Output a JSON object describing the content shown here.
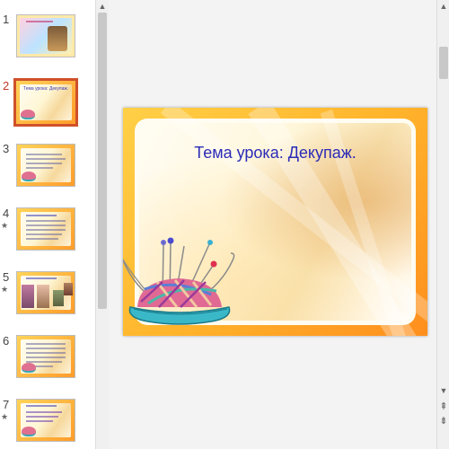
{
  "thumbnails": [
    {
      "number": "1",
      "starred": false,
      "active": false
    },
    {
      "number": "2",
      "starred": false,
      "active": true,
      "title": "Тема урока: Декупаж."
    },
    {
      "number": "3",
      "starred": false,
      "active": false
    },
    {
      "number": "4",
      "starred": true,
      "active": false
    },
    {
      "number": "5",
      "starred": true,
      "active": false
    },
    {
      "number": "6",
      "starred": false,
      "active": false
    },
    {
      "number": "7",
      "starred": true,
      "active": false
    }
  ],
  "slide": {
    "title": "Тема урока: Декупаж."
  },
  "icons": {
    "star": "★",
    "scroll_up": "▲",
    "scroll_down": "▼",
    "prev_slide": "⇞",
    "next_slide": "⇟"
  },
  "colors": {
    "title": "#2b2bb8",
    "active_thumb_border": "#d0502a",
    "frame_orange": "#ffb52c"
  }
}
